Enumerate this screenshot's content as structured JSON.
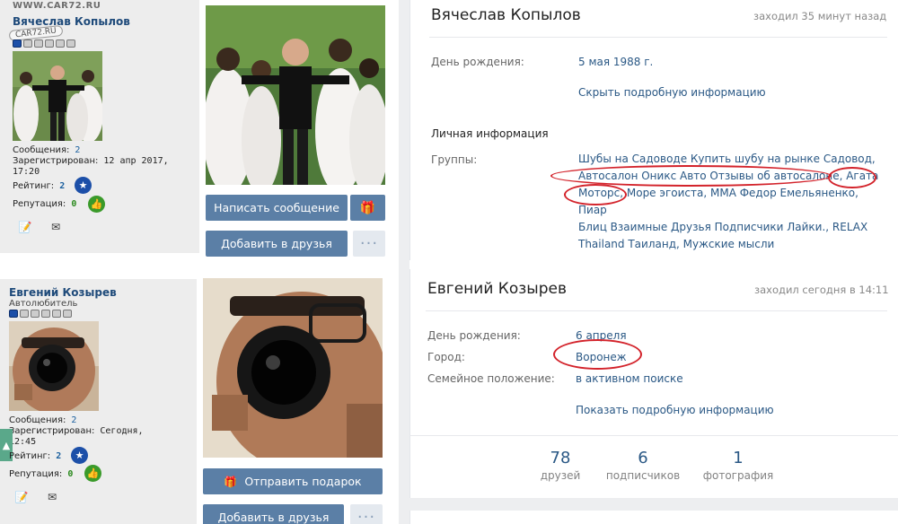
{
  "watermark": "WWW.CAR72.RU",
  "watermark_logo": "CAR72.RU",
  "forum_users": [
    {
      "name": "Вячеслав Копылов",
      "subtitle": "",
      "messages_label": "Сообщения:",
      "messages_value": "2",
      "registered_label": "Зарегистрирован:",
      "registered_value": "12 апр 2017,",
      "registered_value_2": "17:20",
      "rating_label": "Рейтинг:",
      "rating_value": "2",
      "reputation_label": "Репутация:",
      "reputation_value": "0"
    },
    {
      "name": "Евгений Козырев",
      "subtitle": "Автолюбитель",
      "messages_label": "Сообщения:",
      "messages_value": "2",
      "registered_label": "Зарегистрирован:",
      "registered_value": "Сегодня,",
      "registered_value_2": "12:45",
      "rating_label": "Рейтинг:",
      "rating_value": "2",
      "reputation_label": "Репутация:",
      "reputation_value": "0"
    }
  ],
  "vk_buttons": {
    "write_message": "Написать сообщение",
    "add_friend_1": "Добавить в друзья",
    "send_gift": "Отправить подарок",
    "add_friend_2": "Добавить в друзья",
    "more": "···"
  },
  "profile1": {
    "name": "Вячеслав Копылов",
    "online": "заходил 35 минут назад",
    "birthday_label": "День рождения:",
    "birthday_value": "5 мая 1988 г.",
    "hide_info": "Скрыть подробную информацию",
    "personal_info": "Личная информация",
    "groups_label": "Группы:",
    "groups": [
      "Шубы на Садоводе Купить шубу на рынке Садовод,",
      "Автосалон Оникс Авто Отзывы об автосалоне, Агата",
      "Моторс, Море эгоиста, ММА Федор Емельяненко, Пиар",
      "Блиц Взаимные Друзья Подписчики Лайки., RELAX",
      "Thailand Таиланд, Мужские мысли"
    ]
  },
  "profile2": {
    "name": "Евгений Козырев",
    "online": "заходил сегодня в 14:11",
    "birthday_label": "День рождения:",
    "birthday_value": "6 апреля",
    "city_label": "Город:",
    "city_value": "Воронеж",
    "family_label": "Семейное положение:",
    "family_value": "в активном поиске",
    "show_info": "Показать подробную информацию",
    "counters": [
      {
        "num": "78",
        "cap": "друзей"
      },
      {
        "num": "6",
        "cap": "подписчиков"
      },
      {
        "num": "1",
        "cap": "фотография"
      }
    ]
  },
  "colors": {
    "vk_button": "#5b7fa6",
    "vk_link": "#2a5885",
    "annotation": "#d3232b",
    "forum_panel": "#ededed"
  }
}
